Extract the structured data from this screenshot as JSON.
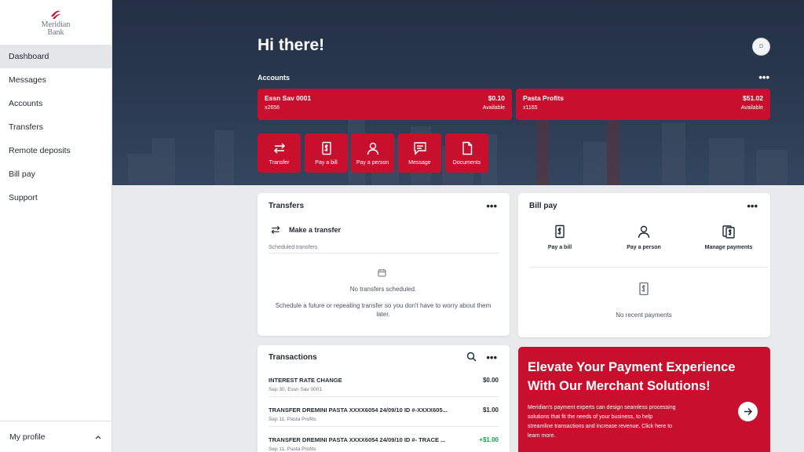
{
  "brand": {
    "name_line1": "Meridian",
    "name_line2": "Bank",
    "accent": "#c8102e"
  },
  "sidebar": {
    "items": [
      {
        "label": "Dashboard",
        "active": true
      },
      {
        "label": "Messages"
      },
      {
        "label": "Accounts"
      },
      {
        "label": "Transfers"
      },
      {
        "label": "Remote deposits"
      },
      {
        "label": "Bill pay"
      },
      {
        "label": "Support"
      }
    ],
    "profile_label": "My profile"
  },
  "header": {
    "greeting": "Hi there!",
    "avatar_initial": "D"
  },
  "accounts": {
    "title": "Accounts",
    "items": [
      {
        "name": "Essn Sav 0001",
        "number": "x2656",
        "balance": "$0.10",
        "status": "Available"
      },
      {
        "name": "Pasta Profits",
        "number": "x1165",
        "balance": "$51.02",
        "status": "Available"
      }
    ]
  },
  "quick_actions": [
    {
      "label": "Transfer",
      "icon": "transfer-icon"
    },
    {
      "label": "Pay a bill",
      "icon": "bill-icon"
    },
    {
      "label": "Pay a person",
      "icon": "person-icon"
    },
    {
      "label": "Message",
      "icon": "message-icon"
    },
    {
      "label": "Documents",
      "icon": "document-icon"
    }
  ],
  "transfers": {
    "title": "Transfers",
    "make_transfer": "Make a transfer",
    "scheduled_label": "Scheduled transfers",
    "empty_title": "No transfers scheduled.",
    "empty_desc": "Schedule a future or repeating transfer so you don't have to worry about them later."
  },
  "bill_pay": {
    "title": "Bill pay",
    "actions": [
      {
        "label": "Pay a bill",
        "icon": "bill-icon"
      },
      {
        "label": "Pay a person",
        "icon": "person-icon"
      },
      {
        "label": "Manage payments",
        "icon": "manage-payments-icon"
      }
    ],
    "empty": "No recent payments"
  },
  "transactions": {
    "title": "Transactions",
    "items": [
      {
        "desc": "INTEREST RATE CHANGE",
        "sub": "Sep 30, Essn Sav 0001",
        "amount": "$0.00"
      },
      {
        "desc": "TRANSFER DREMINI PASTA XXXX6054 24/09/10 ID #-XXXX605...",
        "sub": "Sep 11, Pasta Profits",
        "amount": "$1.00"
      },
      {
        "desc": "TRANSFER DREMINI PASTA XXXX6054 24/09/10 ID #- TRACE ...",
        "sub": "Sep 11, Pasta Profits",
        "amount": "+$1.00",
        "positive": true
      }
    ]
  },
  "promo": {
    "title_line1": "Elevate Your Payment Experience",
    "title_line2": "With Our Merchant Solutions!",
    "text": "Meridian's payment experts can design seamless processing solutions that fit the needs of your business, to help streamline transactions and increase revenue. Click here to learn more."
  }
}
